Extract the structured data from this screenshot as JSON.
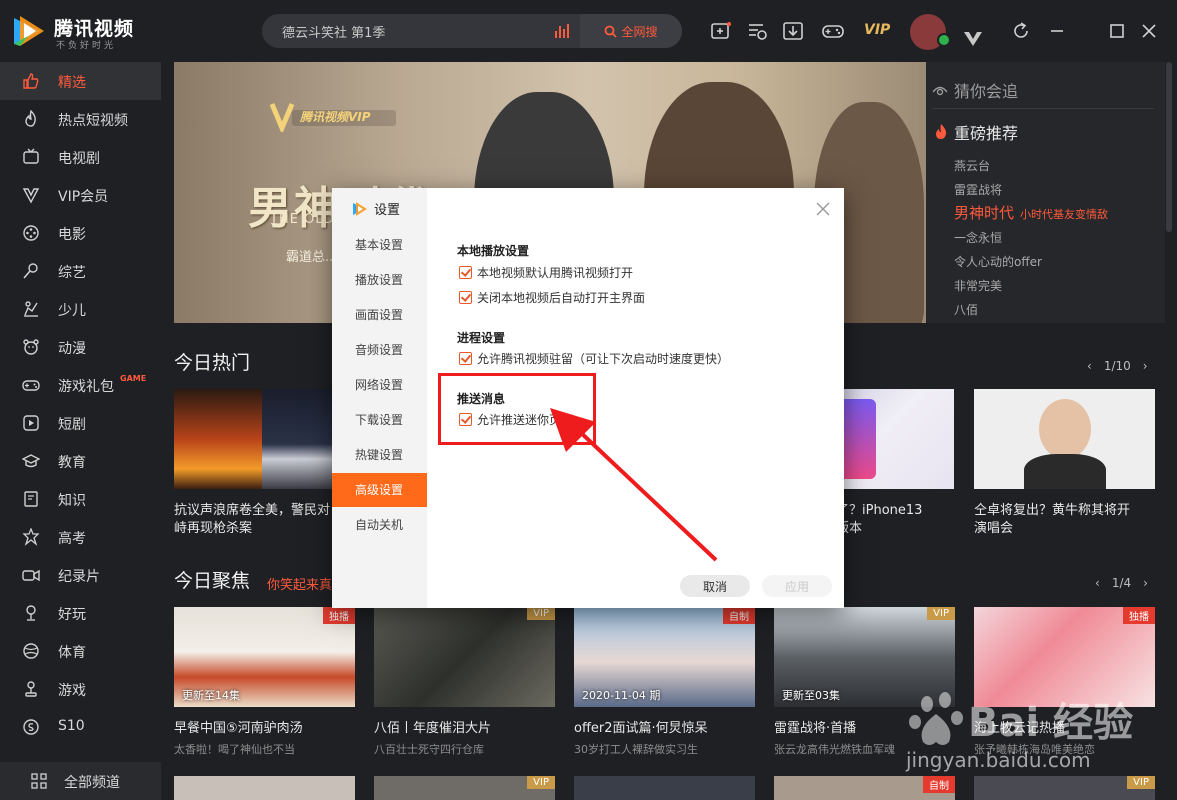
{
  "app": {
    "name": "腾讯视频",
    "slogan": "不负好时光"
  },
  "search": {
    "value": "德云斗笑社 第1季",
    "button": "全网搜"
  },
  "topbar": {
    "vip": "VIP"
  },
  "sidebar": {
    "items": [
      {
        "label": "精选",
        "icon": "thumb-up-icon",
        "active": true
      },
      {
        "label": "热点短视频",
        "icon": "flame-icon"
      },
      {
        "label": "电视剧",
        "icon": "tv-icon"
      },
      {
        "label": "VIP会员",
        "icon": "vip-v-icon"
      },
      {
        "label": "电影",
        "icon": "film-reel-icon"
      },
      {
        "label": "综艺",
        "icon": "microphone-icon"
      },
      {
        "label": "少儿",
        "icon": "child-icon"
      },
      {
        "label": "动漫",
        "icon": "bear-icon"
      },
      {
        "label": "游戏礼包",
        "icon": "gamepad-icon",
        "tag": "GAME"
      },
      {
        "label": "短剧",
        "icon": "play-icon"
      },
      {
        "label": "教育",
        "icon": "graduation-cap-icon"
      },
      {
        "label": "知识",
        "icon": "book-icon"
      },
      {
        "label": "高考",
        "icon": "star-badge-icon"
      },
      {
        "label": "纪录片",
        "icon": "camera-icon"
      },
      {
        "label": "好玩",
        "icon": "trophy-icon"
      },
      {
        "label": "体育",
        "icon": "ball-icon"
      },
      {
        "label": "游戏",
        "icon": "joystick-icon"
      },
      {
        "label": "S10",
        "icon": "s10-icon"
      }
    ],
    "all_channels": "全部频道"
  },
  "banner": {
    "vip_label": "腾讯视频VIP",
    "title": "男神时代",
    "subtitle": "THE OLD ...",
    "tagline": "霸道总..."
  },
  "guess": {
    "header": "猜你会追",
    "recommend": "重磅推荐",
    "items": [
      "燕云台",
      "雷霆战将"
    ],
    "highlight_title": "男神时代",
    "highlight_sub": "小时代基友变情敌",
    "items2": [
      "一念永恒",
      "令人心动的offer",
      "非常完美",
      "八佰"
    ]
  },
  "hot": {
    "title": "今日热门",
    "pager": "1/10",
    "cards": [
      {
        "title": "抗议声浪席卷全美，警民对",
        "title2": "峙再现枪杀案"
      },
      {
        "title": "了？iPhone13",
        "title2": "版本"
      },
      {
        "title": "仝卓将复出？黄牛称其将开",
        "title2": "演唱会"
      }
    ]
  },
  "focus": {
    "title": "今日聚焦",
    "subtitle": "你笑起来真",
    "pager": "1/4",
    "cards": [
      {
        "badge": "独播",
        "ep": "更新至14集",
        "title": "早餐中国⑤河南驴肉汤",
        "sub": "太香啦！喝了神仙也不当"
      },
      {
        "badge": "VIP",
        "ep": "",
        "title": "八佰丨年度催泪大片",
        "sub": "八百壮士死守四行仓库"
      },
      {
        "badge": "自制",
        "ep": "2020-11-04 期",
        "title": "offer2面试篇·何炅惊呆",
        "sub": "30岁打工人裸辞做实习生"
      },
      {
        "badge": "VIP",
        "ep": "更新至03集",
        "title": "雷霆战将·首播",
        "sub": "张云龙高伟光燃铁血军魂"
      },
      {
        "badge": "独播",
        "ep": "",
        "title": "海上牧云记热播",
        "sub": "张予曦韩栋海岛唯美绝恋"
      }
    ]
  },
  "bottom_badges": [
    "VIP",
    "自制",
    "VIP"
  ],
  "dialog": {
    "title": "设置",
    "nav": [
      "基本设置",
      "播放设置",
      "画面设置",
      "音频设置",
      "网络设置",
      "下载设置",
      "热键设置",
      "高级设置",
      "自动关机"
    ],
    "groups": [
      {
        "title": "本地播放设置",
        "options": [
          "本地视频默认用腾讯视频打开",
          "关闭本地视频后自动打开主界面"
        ]
      },
      {
        "title": "进程设置",
        "options": [
          "允许腾讯视频驻留（可让下次启动时速度更快）"
        ]
      },
      {
        "title": "推送消息",
        "options": [
          "允许推送迷你页面"
        ]
      }
    ],
    "cancel": "取消",
    "apply": "应用"
  },
  "watermark": {
    "text": "Bai 经验",
    "url": "jingyan.baidu.com"
  },
  "colors": {
    "accent": "#ff5a3c",
    "dialog_active": "#ff6a1a",
    "highlight": "#ee1c1c",
    "bg": "#1f2024"
  }
}
